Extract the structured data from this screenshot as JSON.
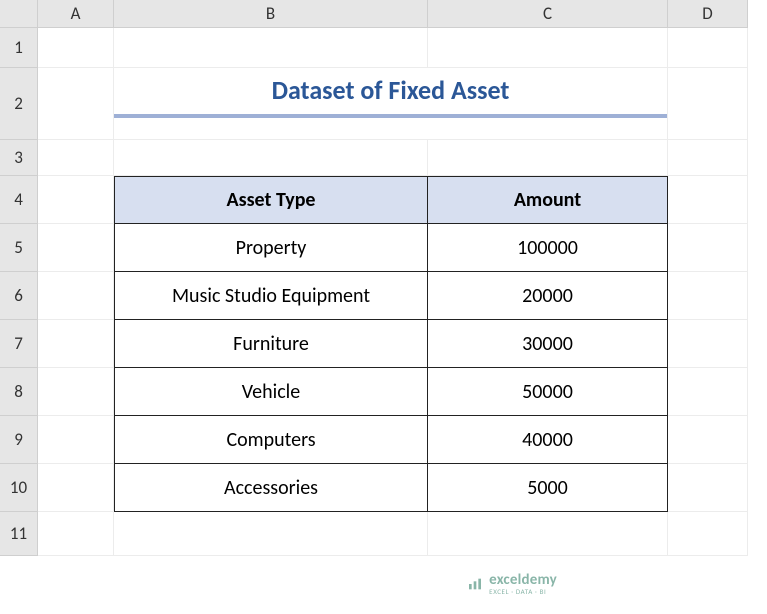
{
  "columns": [
    "A",
    "B",
    "C",
    "D"
  ],
  "rows": [
    "1",
    "2",
    "3",
    "4",
    "5",
    "6",
    "7",
    "8",
    "9",
    "10",
    "11"
  ],
  "title": "Dataset of Fixed Asset",
  "table": {
    "headers": {
      "asset_type": "Asset Type",
      "amount": "Amount"
    },
    "rows": [
      {
        "asset_type": "Property",
        "amount": "100000"
      },
      {
        "asset_type": "Music Studio Equipment",
        "amount": "20000"
      },
      {
        "asset_type": "Furniture",
        "amount": "30000"
      },
      {
        "asset_type": "Vehicle",
        "amount": "50000"
      },
      {
        "asset_type": "Computers",
        "amount": "40000"
      },
      {
        "asset_type": "Accessories",
        "amount": "5000"
      }
    ]
  },
  "watermark": {
    "brand": "exceldemy",
    "tagline": "EXCEL · DATA · BI"
  },
  "chart_data": {
    "type": "table",
    "title": "Dataset of Fixed Asset",
    "columns": [
      "Asset Type",
      "Amount"
    ],
    "rows": [
      [
        "Property",
        100000
      ],
      [
        "Music Studio Equipment",
        20000
      ],
      [
        "Furniture",
        30000
      ],
      [
        "Vehicle",
        50000
      ],
      [
        "Computers",
        40000
      ],
      [
        "Accessories",
        5000
      ]
    ]
  }
}
